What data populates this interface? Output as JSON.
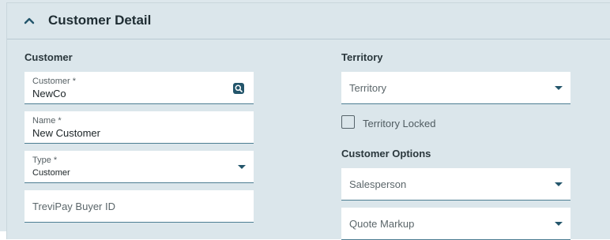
{
  "header": {
    "title": "Customer Detail"
  },
  "left": {
    "section_label": "Customer",
    "customer_field": {
      "label": "Customer *",
      "value": "NewCo"
    },
    "name_field": {
      "label": "Name *",
      "value": "New Customer"
    },
    "type_field": {
      "label": "Type *",
      "value": "Customer"
    },
    "trevipay_field": {
      "placeholder": "TreviPay Buyer ID"
    }
  },
  "right": {
    "territory_section_label": "Territory",
    "territory_select": {
      "placeholder": "Territory"
    },
    "territory_locked": {
      "label": "Territory Locked",
      "checked": false
    },
    "options_section_label": "Customer Options",
    "salesperson_select": {
      "placeholder": "Salesperson"
    },
    "quote_markup_select": {
      "placeholder": "Quote Markup"
    }
  },
  "colors": {
    "accent": "#23556b",
    "panel_bg": "#dbe6eb"
  },
  "icons": {
    "collapse": "chevron-up-icon",
    "lookup": "search-icon",
    "dropdown": "caret-down-icon"
  }
}
